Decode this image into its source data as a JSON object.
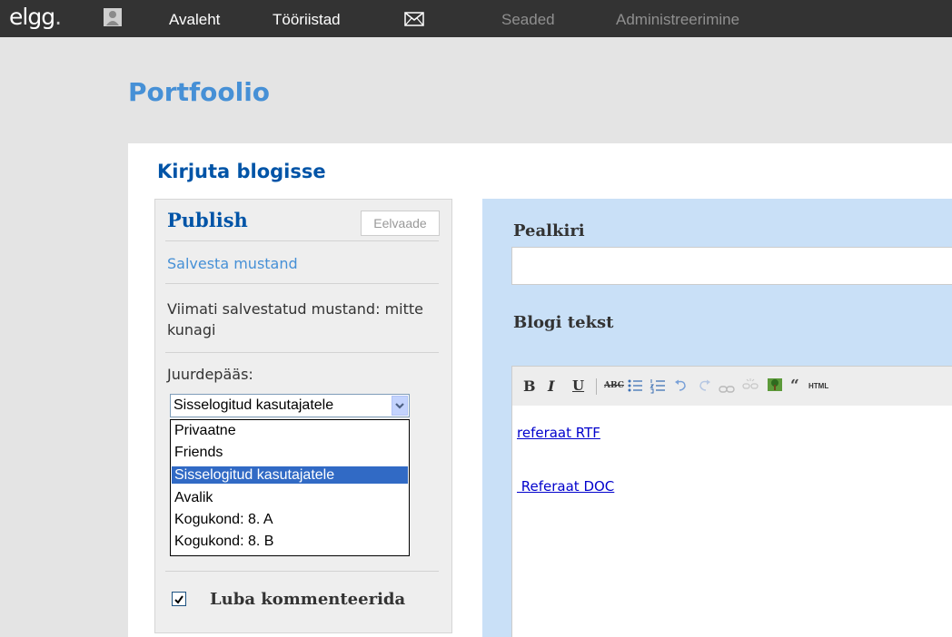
{
  "topbar": {
    "logo": "elgg",
    "logo_dot": ".",
    "nav": [
      {
        "label": "Avaleht"
      },
      {
        "label": "Tööriistad"
      },
      {
        "label": "Seaded"
      },
      {
        "label": "Administreerimine"
      }
    ]
  },
  "page": {
    "title": "Portfoolio",
    "subtitle": "Kirjuta blogisse"
  },
  "sidebar": {
    "heading": "Publish",
    "preview_label": "Eelvaade",
    "save_draft": "Salvesta mustand",
    "last_saved": "Viimati salvestatud mustand: mitte kunagi",
    "access_label": "Juurdepääs:",
    "access_selected": "Sisselogitud kasutajatele",
    "access_options": [
      {
        "label": "Privaatne",
        "selected": false
      },
      {
        "label": "Friends",
        "selected": false
      },
      {
        "label": "Sisselogitud kasutajatele",
        "selected": true
      },
      {
        "label": "Avalik",
        "selected": false
      },
      {
        "label": "Kogukond: 8. A",
        "selected": false
      },
      {
        "label": "Kogukond: 8. B",
        "selected": false
      }
    ],
    "comments_label": "Luba kommenteerida",
    "comments_checked": true
  },
  "main": {
    "title_label": "Pealkiri",
    "title_value": "",
    "body_label": "Blogi tekst",
    "toolbar": {
      "bold": "B",
      "italic": "I",
      "underline": "U",
      "strike": "ABC",
      "html": "HTML"
    },
    "editor_links": [
      {
        "text": "referaat RTF"
      },
      {
        "text": " Referaat DOC"
      }
    ]
  },
  "colors": {
    "topbar": "#333333",
    "accent": "#4690d6",
    "heading": "#0054a7",
    "panel": "#c9e0f7",
    "selection": "#316ac5"
  }
}
